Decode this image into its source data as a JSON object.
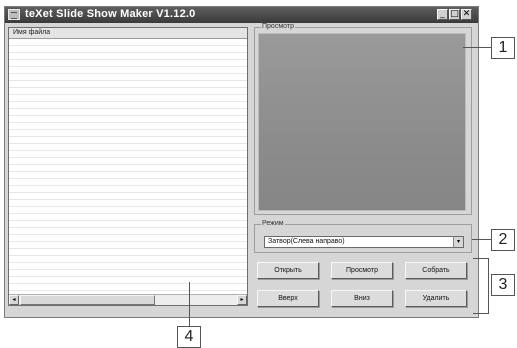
{
  "window": {
    "title": "teXet Slide Show Maker V1.12.0",
    "controls": {
      "minimize": "_",
      "maximize": "□",
      "close": "✕"
    }
  },
  "file_list": {
    "column_header": "Имя файла",
    "rows": [],
    "scroll_left": "◂",
    "scroll_right": "▸"
  },
  "preview_group": {
    "label": "Просмотр"
  },
  "mode_group": {
    "label": "Режим",
    "selected": "Затвор(Слева направо)",
    "dropdown_arrow": "▾"
  },
  "buttons": {
    "open": "Открыть",
    "preview": "Просмотр",
    "build": "Собрать",
    "up": "Вверх",
    "down": "Вниз",
    "delete": "Удалить"
  },
  "callouts": {
    "c1": "1",
    "c2": "2",
    "c3": "3",
    "c4": "4"
  }
}
